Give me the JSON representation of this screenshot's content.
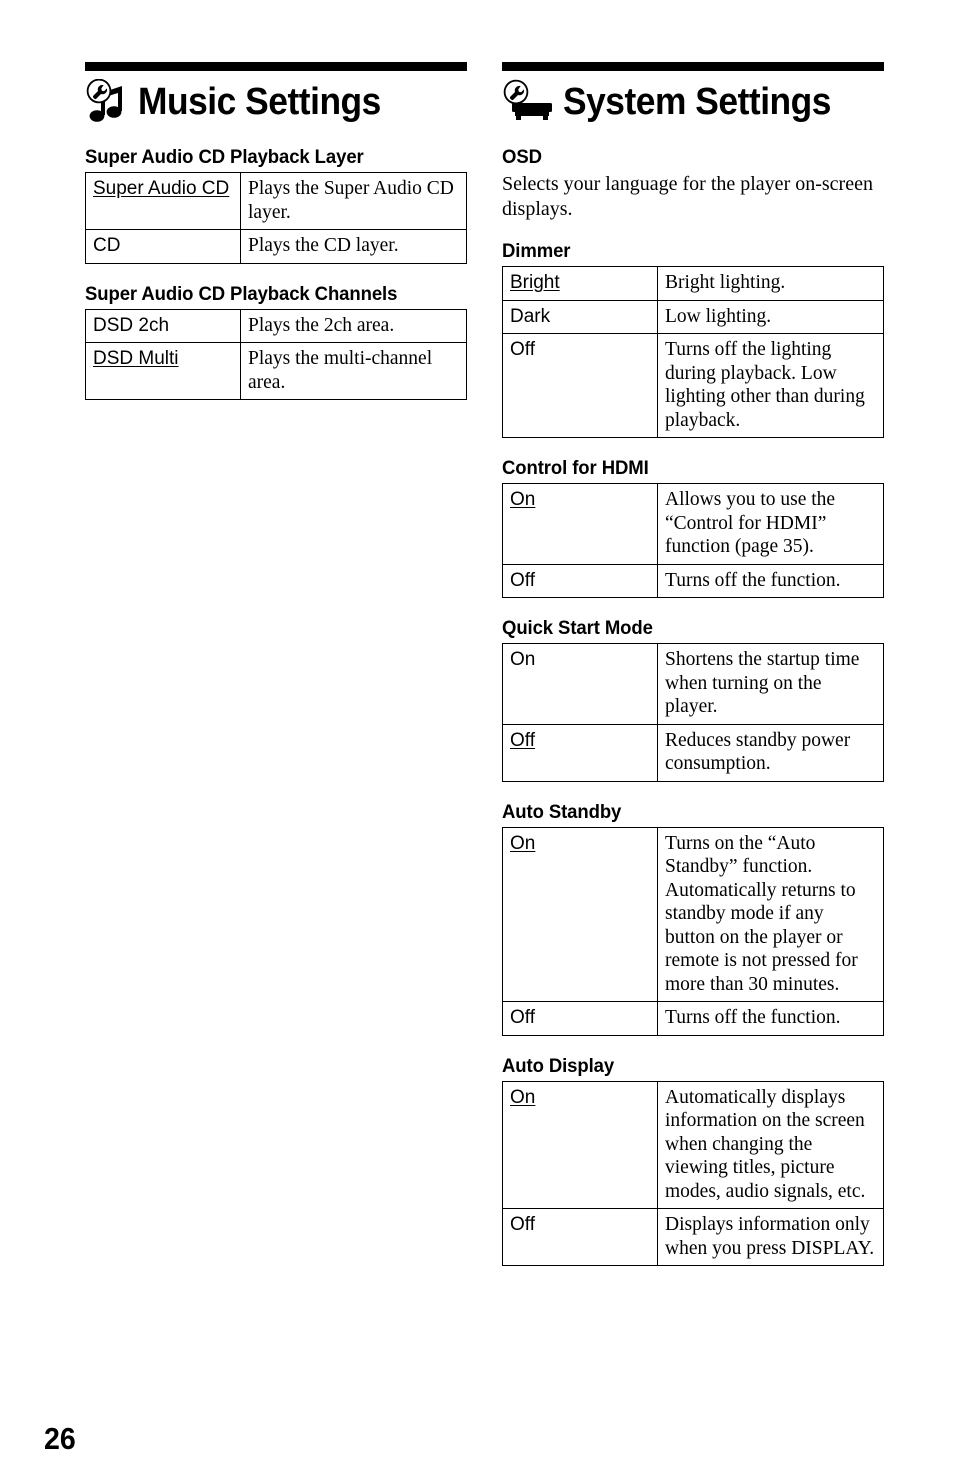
{
  "page": {
    "folio": "26"
  },
  "left_column": {
    "chapter": {
      "icon": "music-note-wrench-icon",
      "title": "Music Settings"
    },
    "sections": [
      {
        "heading": "Super Audio CD Playback Layer",
        "rows": [
          {
            "key": "Super Audio CD",
            "key_default": true,
            "value": "Plays the Super Audio CD layer."
          },
          {
            "key": "CD",
            "key_default": false,
            "value": "Plays the CD layer."
          }
        ]
      },
      {
        "heading": "Super Audio CD Playback Channels",
        "rows": [
          {
            "key": "DSD 2ch",
            "key_default": false,
            "value": "Plays the 2ch area."
          },
          {
            "key": "DSD Multi",
            "key_default": true,
            "value": "Plays the multi-channel area."
          }
        ]
      }
    ]
  },
  "right_column": {
    "chapter": {
      "icon": "player-device-wrench-icon",
      "title": "System Settings"
    },
    "sections": [
      {
        "heading": "OSD",
        "description": "Selects your language for the player on-screen displays.",
        "rows": []
      },
      {
        "heading": "Dimmer",
        "rows": [
          {
            "key": "Bright",
            "key_default": true,
            "value": "Bright lighting."
          },
          {
            "key": "Dark",
            "key_default": false,
            "value": "Low lighting."
          },
          {
            "key": "Off",
            "key_default": false,
            "value": "Turns off the lighting during playback. Low lighting other than during playback."
          }
        ]
      },
      {
        "heading": "Control for HDMI",
        "rows": [
          {
            "key": "On",
            "key_default": true,
            "value": "Allows you to use the “Control for HDMI” function (page 35)."
          },
          {
            "key": "Off",
            "key_default": false,
            "value": "Turns off the function."
          }
        ]
      },
      {
        "heading": "Quick Start Mode",
        "rows": [
          {
            "key": "On",
            "key_default": false,
            "value": "Shortens the startup time when turning on the player."
          },
          {
            "key": "Off",
            "key_default": true,
            "value": "Reduces standby power consumption."
          }
        ]
      },
      {
        "heading": "Auto Standby",
        "rows": [
          {
            "key": "On",
            "key_default": true,
            "value": "Turns on the “Auto Standby” function. Automatically returns to standby mode if any button on the player or remote is not pressed for more than 30 minutes."
          },
          {
            "key": "Off",
            "key_default": false,
            "value": "Turns off the function."
          }
        ]
      },
      {
        "heading": "Auto Display",
        "rows": [
          {
            "key": "On",
            "key_default": true,
            "value": "Automatically displays information on the screen when changing the viewing titles, picture modes, audio signals, etc."
          },
          {
            "key": "Off",
            "key_default": false,
            "value": "Displays information only when you press DISPLAY."
          }
        ]
      }
    ]
  }
}
